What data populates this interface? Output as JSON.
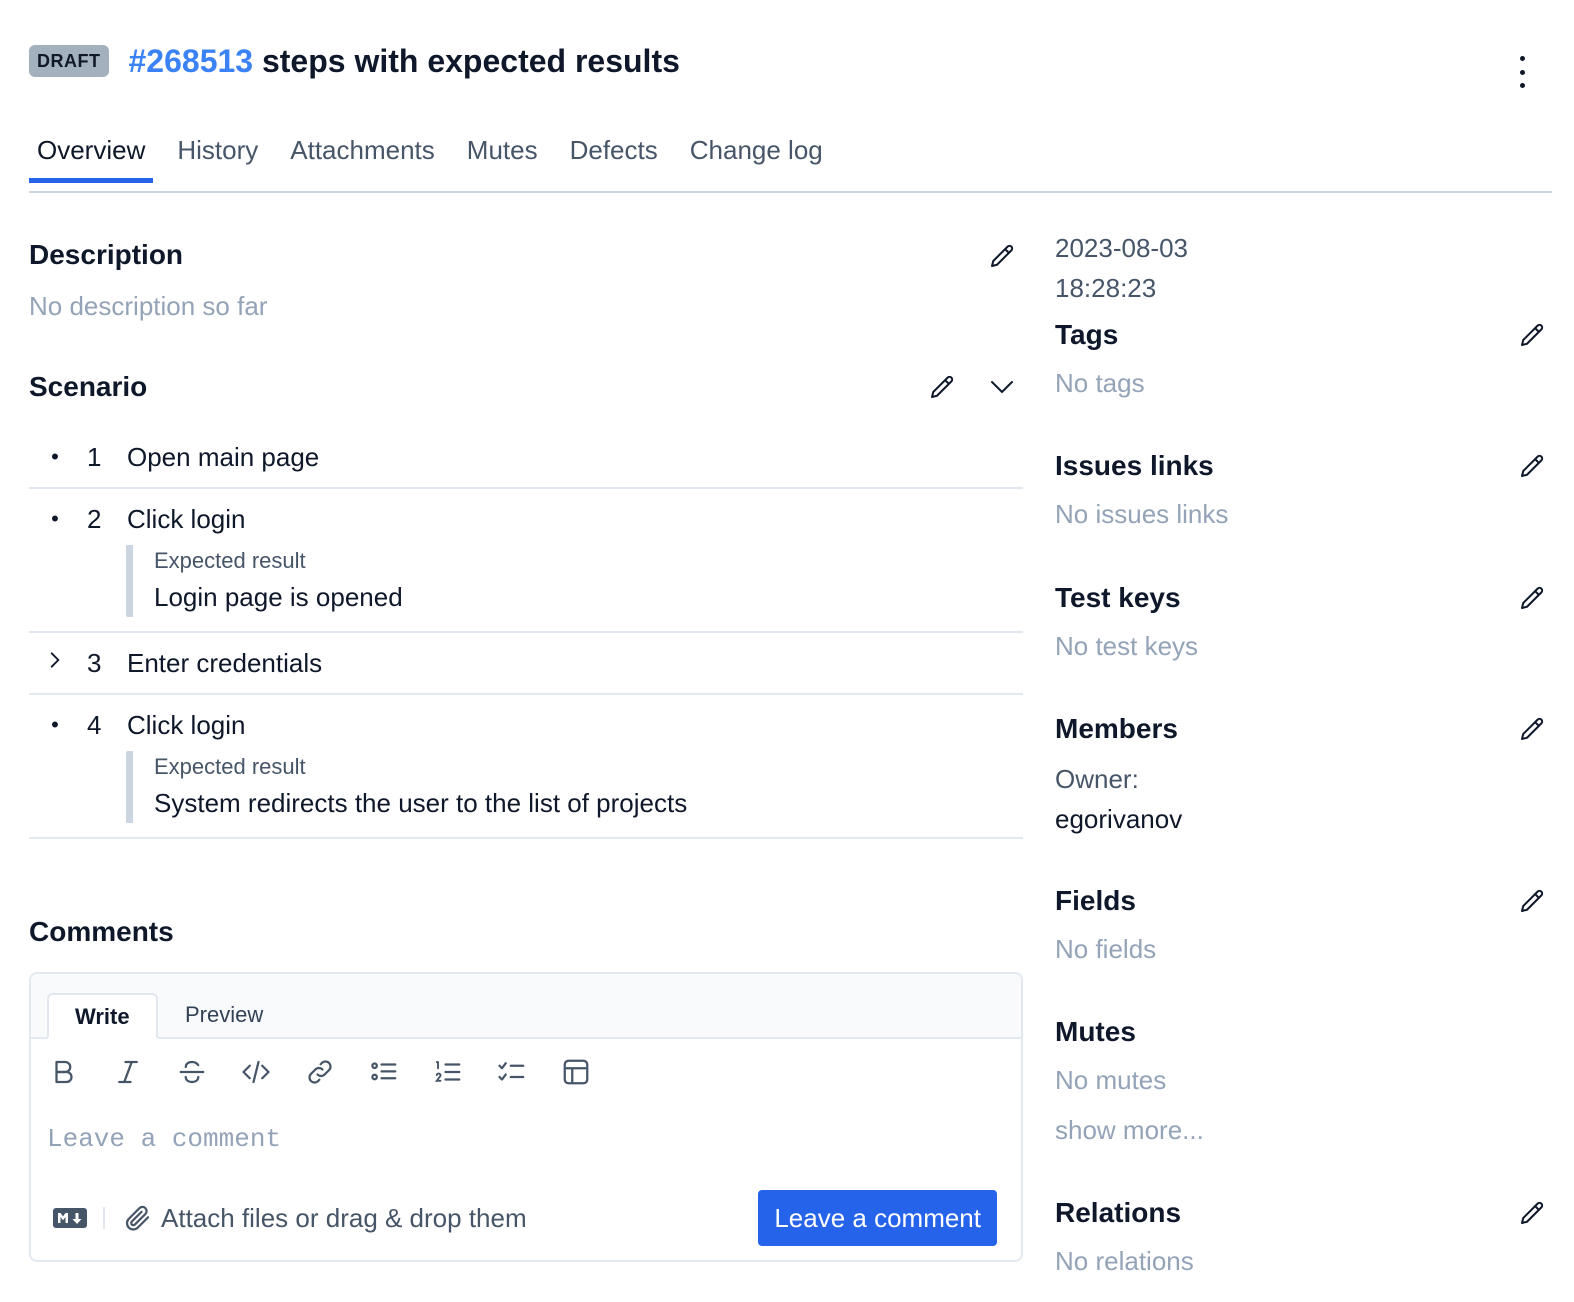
{
  "header": {
    "badge": "DRAFT",
    "id": "#268513",
    "title": "steps with expected results"
  },
  "tabs": [
    {
      "label": "Overview",
      "active": true
    },
    {
      "label": "History"
    },
    {
      "label": "Attachments"
    },
    {
      "label": "Mutes"
    },
    {
      "label": "Defects"
    },
    {
      "label": "Change log"
    }
  ],
  "description": {
    "heading": "Description",
    "empty": "No description so far"
  },
  "scenario": {
    "heading": "Scenario",
    "steps": [
      {
        "num": "1",
        "text": "Open main page",
        "marker": "•"
      },
      {
        "num": "2",
        "text": "Click login",
        "marker": "•",
        "expected_label": "Expected result",
        "expected": "Login page is opened"
      },
      {
        "num": "3",
        "text": "Enter credentials",
        "marker": "›"
      },
      {
        "num": "4",
        "text": "Click login",
        "marker": "•",
        "expected_label": "Expected result",
        "expected": "System redirects the user to the list of projects"
      }
    ]
  },
  "comments": {
    "heading": "Comments",
    "tab_write": "Write",
    "tab_preview": "Preview",
    "placeholder": "Leave a comment",
    "attach": "Attach files or drag & drop them",
    "submit": "Leave a comment",
    "toolbar": [
      "bold",
      "italic",
      "strikethrough",
      "code",
      "link",
      "bullet-list",
      "numbered-list",
      "task-list",
      "table"
    ]
  },
  "sidebar": {
    "date": "2023-08-03",
    "time": "18:28:23",
    "tags": {
      "heading": "Tags",
      "empty": "No tags"
    },
    "issues": {
      "heading": "Issues links",
      "empty": "No issues links"
    },
    "test_keys": {
      "heading": "Test keys",
      "empty": "No test keys"
    },
    "members": {
      "heading": "Members",
      "owner_label": "Owner:",
      "owner": "egorivanov"
    },
    "fields": {
      "heading": "Fields",
      "empty": "No fields"
    },
    "mutes": {
      "heading": "Mutes",
      "empty": "No mutes",
      "show_more": "show more..."
    },
    "relations": {
      "heading": "Relations",
      "empty": "No relations"
    }
  },
  "colors": {
    "accent": "#2563eb",
    "id_link": "#3b82f6",
    "badge_bg": "#a3b1bf",
    "muted_text": "#94a3b8",
    "border": "#e2e8f0"
  }
}
